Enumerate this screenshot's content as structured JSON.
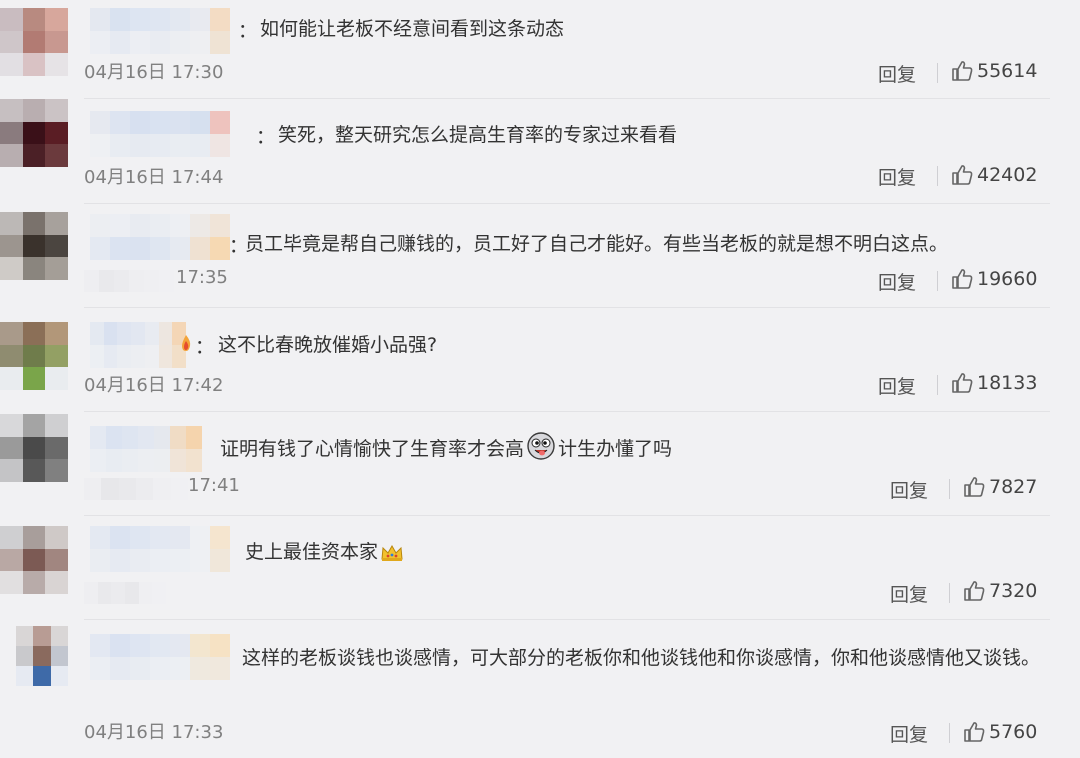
{
  "separator": "：",
  "reply_label": "回复",
  "comments": [
    {
      "text": "如何能让老板不经意间看到这条动态",
      "time": "04月16日 17:30",
      "likes": "55614"
    },
    {
      "text": "笑死，整天研究怎么提高生育率的专家过来看看",
      "time": "04月16日 17:44",
      "likes": "42402"
    },
    {
      "text": "员工毕竟是帮自己赚钱的，员工好了自己才能好。有些当老板的就是想不明白这点。",
      "time": "17:35",
      "likes": "19660"
    },
    {
      "text": "这不比春晚放催婚小品强?",
      "time": "04月16日 17:42",
      "likes": "18133"
    },
    {
      "text_before": "证明有钱了心情愉快了生育率才会高",
      "emoji": "funny-face-emoji",
      "text_after": "计生办懂了吗",
      "time": "17:41",
      "likes": "7827"
    },
    {
      "text": "史上最佳资本家",
      "emoji": "crown-emoji",
      "time": "",
      "likes": "7320"
    },
    {
      "text": "这样的老板谈钱也谈感情，可大部分的老板你和他谈钱他和你谈感情，你和他谈感情他又谈钱。",
      "time": "04月16日 17:33",
      "likes": "5760"
    }
  ],
  "colors": {
    "background": "#f1f1f3",
    "text": "#333333",
    "timestamp": "#808080",
    "divider": "#e2e2e5"
  }
}
